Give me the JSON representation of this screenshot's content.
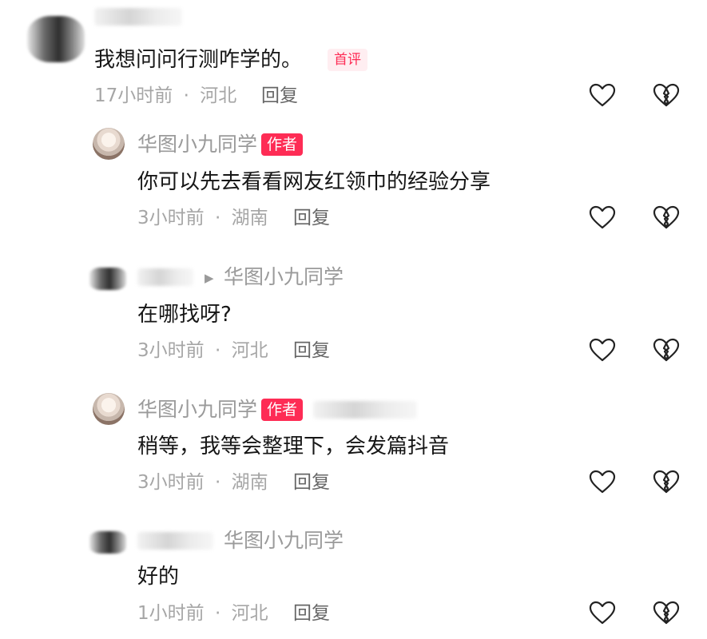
{
  "comments": [
    {
      "text": "我想问问行测咋学的。",
      "badge": "首评",
      "time": "17小时前",
      "separator": "·",
      "location": "河北",
      "reply": "回复"
    },
    {
      "username": "华图小九同学",
      "badge": "作者",
      "text": "你可以先去看看网友红领巾的经验分享",
      "time": "3小时前",
      "separator": "·",
      "location": "湖南",
      "reply": "回复"
    },
    {
      "reply_to": "华图小九同学",
      "text": "在哪找呀?",
      "time": "3小时前",
      "separator": "·",
      "location": "河北",
      "reply": "回复"
    },
    {
      "username": "华图小九同学",
      "badge": "作者",
      "text": "稍等，我等会整理下，会发篇抖音",
      "time": "3小时前",
      "separator": "·",
      "location": "湖南",
      "reply": "回复"
    },
    {
      "reply_to": "华图小九同学",
      "text": "好的",
      "time": "1小时前",
      "separator": "·",
      "location": "河北",
      "reply": "回复"
    }
  ],
  "icons": {
    "like": "heart-outline-icon",
    "dislike": "broken-heart-icon"
  },
  "colors": {
    "accent": "#fe2c55",
    "text": "#161616",
    "muted": "#a6a6a6"
  }
}
